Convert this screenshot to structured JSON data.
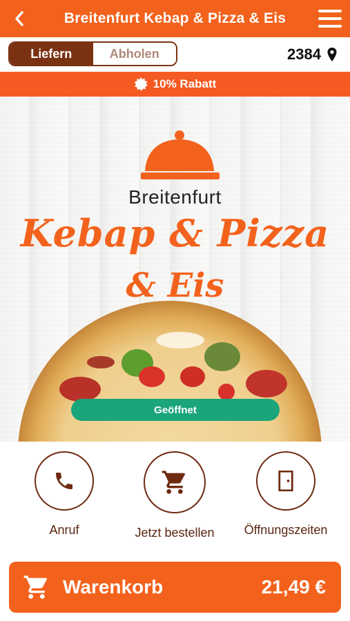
{
  "header": {
    "title": "Breitenfurt Kebap & Pizza & Eis"
  },
  "mode": {
    "deliver": "Liefern",
    "pickup": "Abholen",
    "zip": "2384"
  },
  "promo": {
    "text": "10% Rabatt"
  },
  "hero": {
    "city": "Breitenfurt",
    "brand_line1": "Kebap & Pizza",
    "brand_line2": "& Eis",
    "status": "Geöffnet"
  },
  "actions": [
    {
      "label": "Anruf",
      "icon": "phone-icon"
    },
    {
      "label": "Jetzt bestellen",
      "icon": "cart-icon"
    },
    {
      "label": "Öffnungszeiten",
      "icon": "door-icon"
    }
  ],
  "cart": {
    "label": "Warenkorb",
    "total": "21,49 €"
  },
  "colors": {
    "primary": "#f3621c",
    "dark": "#7a3212",
    "open": "#1aa57a"
  }
}
